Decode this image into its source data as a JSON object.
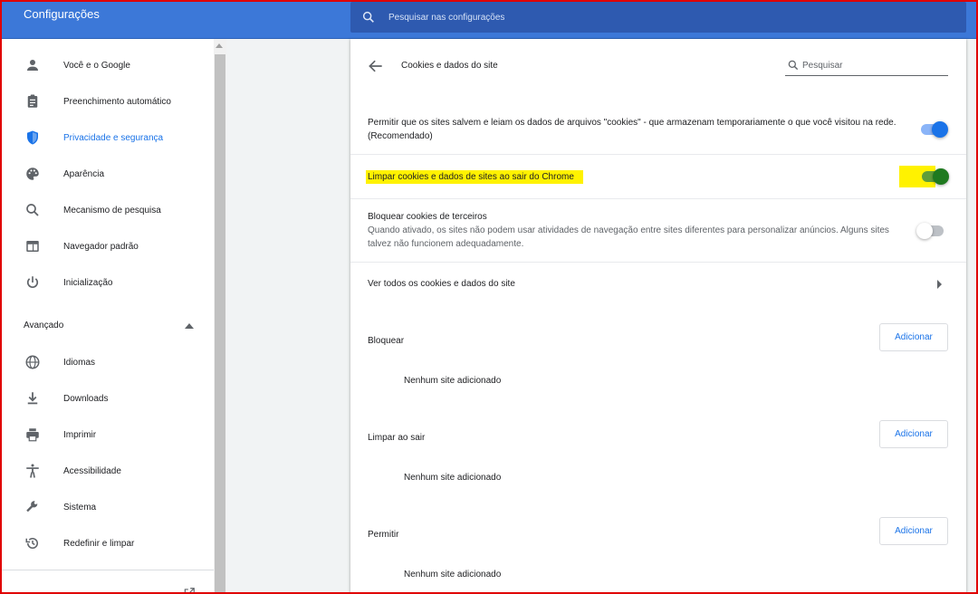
{
  "app": {
    "title": "Configurações"
  },
  "search": {
    "placeholder": "Pesquisar nas configurações"
  },
  "sidebar": {
    "items": [
      {
        "label": "Você e o Google",
        "icon": "person-icon"
      },
      {
        "label": "Preenchimento automático",
        "icon": "clipboard-icon"
      },
      {
        "label": "Privacidade e segurança",
        "icon": "shield-icon",
        "active": true
      },
      {
        "label": "Aparência",
        "icon": "palette-icon"
      },
      {
        "label": "Mecanismo de pesquisa",
        "icon": "search-icon"
      },
      {
        "label": "Navegador padrão",
        "icon": "browser-icon"
      },
      {
        "label": "Inicialização",
        "icon": "power-icon"
      }
    ],
    "advanced": {
      "label": "Avançado",
      "items": [
        {
          "label": "Idiomas",
          "icon": "globe-icon"
        },
        {
          "label": "Downloads",
          "icon": "download-icon"
        },
        {
          "label": "Imprimir",
          "icon": "printer-icon"
        },
        {
          "label": "Acessibilidade",
          "icon": "accessibility-icon"
        },
        {
          "label": "Sistema",
          "icon": "wrench-icon"
        },
        {
          "label": "Redefinir e limpar",
          "icon": "history-icon"
        }
      ]
    }
  },
  "page": {
    "title": "Cookies e dados do site",
    "search_placeholder": "Pesquisar",
    "settings": {
      "allow_cookies": {
        "line1": "Permitir que os sites salvem e leiam os dados de arquivos \"cookies\" - que armazenam temporariamente o que você visitou na rede.",
        "line2": "(Recomendado)",
        "enabled": true
      },
      "clear_on_exit": {
        "label": "Limpar cookies e dados de sites ao sair do Chrome",
        "enabled": true
      },
      "block_third_party": {
        "label": "Bloquear cookies de terceiros",
        "desc_line1": "Quando ativado, os sites não podem usar atividades de navegação entre sites diferentes para personalizar anúncios. Alguns sites",
        "desc_line2": "talvez não funcionem adequadamente.",
        "enabled": false
      },
      "see_all": {
        "label": "Ver todos os cookies e dados do site"
      }
    },
    "lists": [
      {
        "label": "Bloquear",
        "button": "Adicionar",
        "empty": "Nenhum site adicionado"
      },
      {
        "label": "Limpar ao sair",
        "button": "Adicionar",
        "empty": "Nenhum site adicionado"
      },
      {
        "label": "Permitir",
        "button": "Adicionar",
        "empty": "Nenhum site adicionado"
      }
    ]
  },
  "colors": {
    "topbar": "#3c78d8",
    "accent": "#1a73e8",
    "highlight": "#fff200",
    "frame": "#e00000"
  }
}
